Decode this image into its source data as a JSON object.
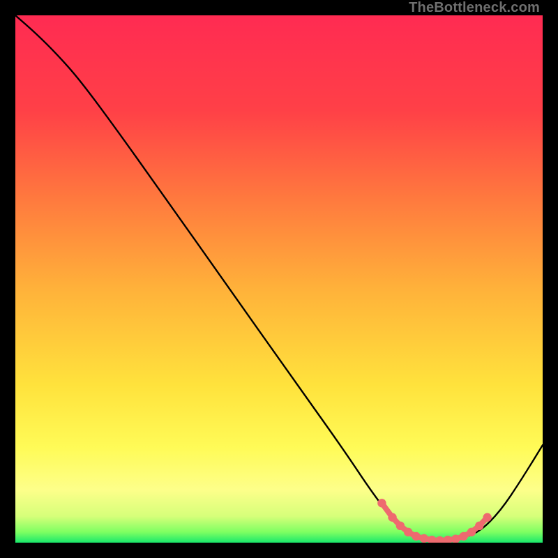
{
  "watermark": "TheBottleneck.com",
  "chart_data": {
    "type": "line",
    "title": "",
    "xlabel": "",
    "ylabel": "",
    "xlim": [
      0,
      100
    ],
    "ylim": [
      0,
      100
    ],
    "background_gradient_stops": [
      {
        "offset": 0,
        "color": "#ff2b52"
      },
      {
        "offset": 18,
        "color": "#ff4047"
      },
      {
        "offset": 35,
        "color": "#ff7a3e"
      },
      {
        "offset": 52,
        "color": "#ffb23a"
      },
      {
        "offset": 70,
        "color": "#ffe23c"
      },
      {
        "offset": 82,
        "color": "#fffb57"
      },
      {
        "offset": 90,
        "color": "#fdff8a"
      },
      {
        "offset": 95,
        "color": "#d6ff7a"
      },
      {
        "offset": 98,
        "color": "#7eff62"
      },
      {
        "offset": 100,
        "color": "#19e86b"
      }
    ],
    "series": [
      {
        "name": "curve",
        "stroke": "#000000",
        "points": [
          {
            "x": 0,
            "y": 100
          },
          {
            "x": 4,
            "y": 96.5
          },
          {
            "x": 8,
            "y": 92.5
          },
          {
            "x": 12,
            "y": 88.0
          },
          {
            "x": 18,
            "y": 80.0
          },
          {
            "x": 28,
            "y": 66.0
          },
          {
            "x": 40,
            "y": 49.0
          },
          {
            "x": 52,
            "y": 32.0
          },
          {
            "x": 62,
            "y": 18.0
          },
          {
            "x": 68,
            "y": 9.0
          },
          {
            "x": 72,
            "y": 4.0
          },
          {
            "x": 76,
            "y": 1.2
          },
          {
            "x": 80,
            "y": 0.4
          },
          {
            "x": 84,
            "y": 0.6
          },
          {
            "x": 88,
            "y": 2.0
          },
          {
            "x": 92,
            "y": 6.0
          },
          {
            "x": 96,
            "y": 12.0
          },
          {
            "x": 100,
            "y": 18.5
          }
        ]
      }
    ],
    "highlight": {
      "name": "bottleneck-zone",
      "color": "#ee6a6f",
      "points": [
        {
          "x": 69.5,
          "y": 7.5
        },
        {
          "x": 71.5,
          "y": 4.8
        },
        {
          "x": 73.0,
          "y": 3.2
        },
        {
          "x": 74.5,
          "y": 2.0
        },
        {
          "x": 76.0,
          "y": 1.2
        },
        {
          "x": 77.5,
          "y": 0.8
        },
        {
          "x": 79.0,
          "y": 0.5
        },
        {
          "x": 80.5,
          "y": 0.4
        },
        {
          "x": 82.0,
          "y": 0.5
        },
        {
          "x": 83.5,
          "y": 0.7
        },
        {
          "x": 85.0,
          "y": 1.2
        },
        {
          "x": 86.5,
          "y": 2.0
        },
        {
          "x": 88.0,
          "y": 3.2
        },
        {
          "x": 89.5,
          "y": 4.8
        }
      ]
    }
  }
}
